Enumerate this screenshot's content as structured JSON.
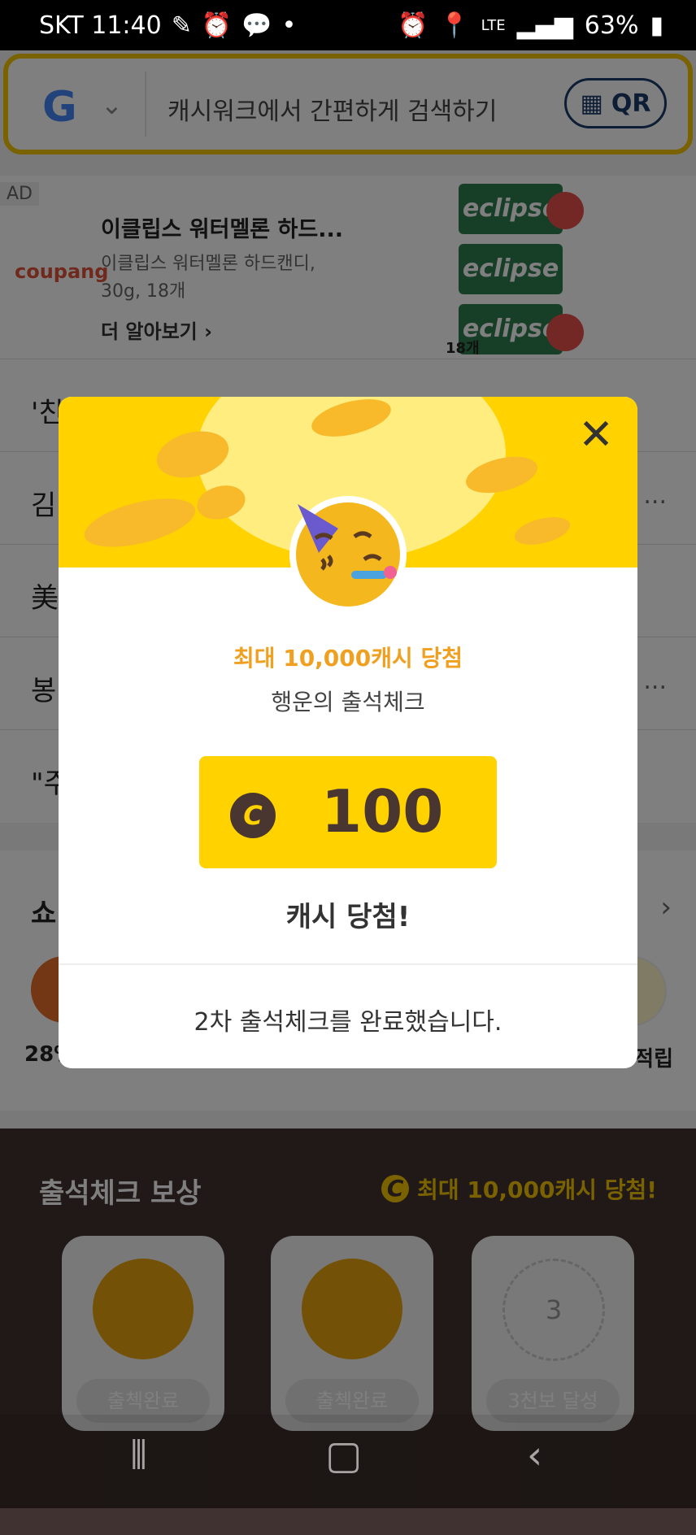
{
  "status_bar": {
    "carrier_time": "SKT 11:40",
    "network": "LTE",
    "battery": "63%"
  },
  "search": {
    "logo": "G",
    "placeholder": "캐시워크에서 간편하게 검색하기",
    "qr_label": "QR"
  },
  "ad": {
    "tag": "AD",
    "brand": "coupang",
    "title": "이클립스 워터멜론 하드...",
    "description": "이클립스 워터멜론 하드캔디, 30g, 18개",
    "more_label": "더 알아보기",
    "product_label": "eclipse",
    "product_count": "18개"
  },
  "feed_rows": [
    {
      "text": "'친",
      "ellipsis": ""
    },
    {
      "text": "김",
      "ellipsis": "..."
    },
    {
      "text": "美",
      "ellipsis": ""
    },
    {
      "text": "봉",
      "ellipsis": "..."
    },
    {
      "text": "\"주",
      "ellipsis": ""
    }
  ],
  "shop": {
    "heading": "쇼",
    "item1_label": "28%",
    "item2_label": "적립"
  },
  "attendance": {
    "title": "출석체크 보상",
    "promo": "최대 10,000캐시 당첨!",
    "cards": [
      {
        "label": "출첵완료"
      },
      {
        "label": "출첵완료"
      },
      {
        "number": "3",
        "label": "3천보 달성"
      }
    ]
  },
  "modal": {
    "headline": "최대 10,000캐시 당첨",
    "subtitle": "행운의 출석체크",
    "coin_symbol": "C",
    "prize_amount": "100",
    "won_text": "캐시 당첨!",
    "completion": "2차 출석체크를 완료했습니다.",
    "close_symbol": "✕"
  },
  "colors": {
    "accent": "#ffd200",
    "brown": "#4a3630",
    "orange_text": "#f0a020"
  }
}
